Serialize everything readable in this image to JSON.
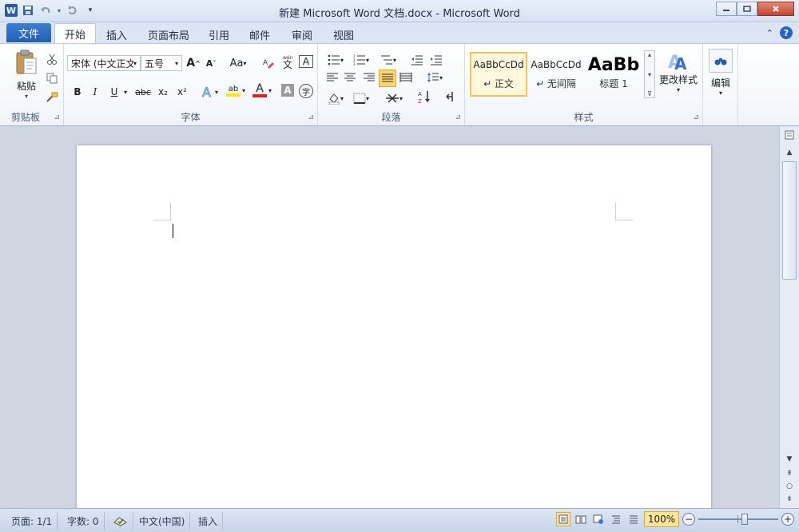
{
  "window": {
    "title": "新建 Microsoft Word 文档.docx  -  Microsoft Word",
    "logo_letter": "W",
    "controls": {
      "minimize": "▭",
      "maximize": "▢",
      "close": "✕"
    }
  },
  "quick_access": {
    "icons": [
      "word-logo",
      "save-icon",
      "undo-icon",
      "redo-icon",
      "customize-icon"
    ]
  },
  "tabs": {
    "file": "文件",
    "items": [
      "开始",
      "插入",
      "页面布局",
      "引用",
      "邮件",
      "审阅",
      "视图"
    ],
    "active": "开始"
  },
  "ribbon": {
    "clipboard": {
      "label": "剪贴板",
      "paste": "粘贴"
    },
    "font": {
      "label": "字体",
      "font_name": "宋体 (中文正文",
      "font_size": "五号",
      "grow": "A",
      "shrink": "A",
      "change_case": "Aa",
      "bold": "B",
      "italic": "I",
      "underline": "U",
      "strikethrough": "abc",
      "subscript": "x₂",
      "superscript": "x²",
      "highlight": "ab",
      "font_color": "A",
      "char_shading": "A",
      "enclose": "字"
    },
    "paragraph": {
      "label": "段落"
    },
    "styles": {
      "label": "样式",
      "items": [
        {
          "sample": "AaBbCcDd",
          "name": "↵ 正文"
        },
        {
          "sample": "AaBbCcDd",
          "name": "↵ 无间隔"
        },
        {
          "sample": "AaBb",
          "name": "标题 1"
        }
      ],
      "change_styles": "更改样式"
    },
    "editing": {
      "label": "编辑"
    }
  },
  "statusbar": {
    "page": "页面: 1/1",
    "words": "字数: 0",
    "language": "中文(中国)",
    "mode": "插入",
    "zoom": "100%"
  },
  "colors": {
    "accent": "#2a5aa8",
    "highlight_yellow": "#ffe600",
    "font_color_red": "#e02020"
  }
}
